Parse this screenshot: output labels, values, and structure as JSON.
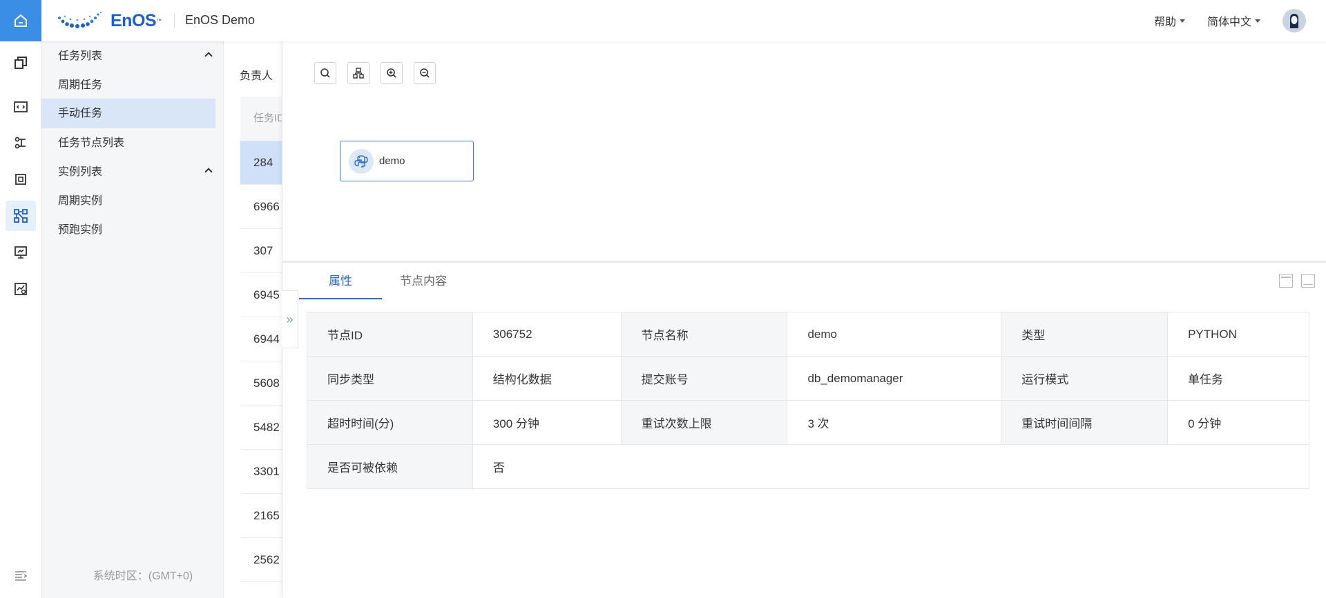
{
  "header": {
    "brand": "EnOS",
    "trademark": "™",
    "app_title": "EnOS Demo",
    "help_label": "帮助",
    "language_label": "简体中文"
  },
  "colors": {
    "accent": "#2c6bc7",
    "rail_active": "#3a8ee6",
    "selected_bg": "#d9e6f8"
  },
  "rail": {
    "icons": [
      "home-icon",
      "copy-icon",
      "code-icon",
      "tree-icon",
      "chip-icon",
      "workflow-icon",
      "monitor-icon",
      "chart-search-icon",
      "menu-collapse-icon"
    ]
  },
  "sidenav": {
    "group1": "任务列表",
    "item_periodic_task": "周期任务",
    "item_manual_task": "手动任务",
    "item_task_nodes": "任务节点列表",
    "group2": "实例列表",
    "item_periodic_instance": "周期实例",
    "item_prerun_instance": "预跑实例",
    "timezone": "系统时区：(GMT+0)"
  },
  "list": {
    "owner_label": "负责人",
    "header": "任务ID",
    "rows": [
      "284",
      "6966",
      "307",
      "6945",
      "6944",
      "5608",
      "5482",
      "3301",
      "2165",
      "2562"
    ]
  },
  "canvas": {
    "node_label": "demo"
  },
  "tabs": {
    "attributes": "属性",
    "node_content": "节点内容"
  },
  "props": {
    "node_id_k": "节点ID",
    "node_id_v": "306752",
    "node_name_k": "节点名称",
    "node_name_v": "demo",
    "type_k": "类型",
    "type_v": "PYTHON",
    "sync_type_k": "同步类型",
    "sync_type_v": "结构化数据",
    "account_k": "提交账号",
    "account_v": "db_demomanager",
    "run_mode_k": "运行模式",
    "run_mode_v": "单任务",
    "timeout_k": "超时时间(分)",
    "timeout_v": "300 分钟",
    "retry_k": "重试次数上限",
    "retry_v": "3 次",
    "retry_interval_k": "重试时间间隔",
    "retry_interval_v": "0 分钟",
    "dependable_k": "是否可被依赖",
    "dependable_v": "否"
  }
}
